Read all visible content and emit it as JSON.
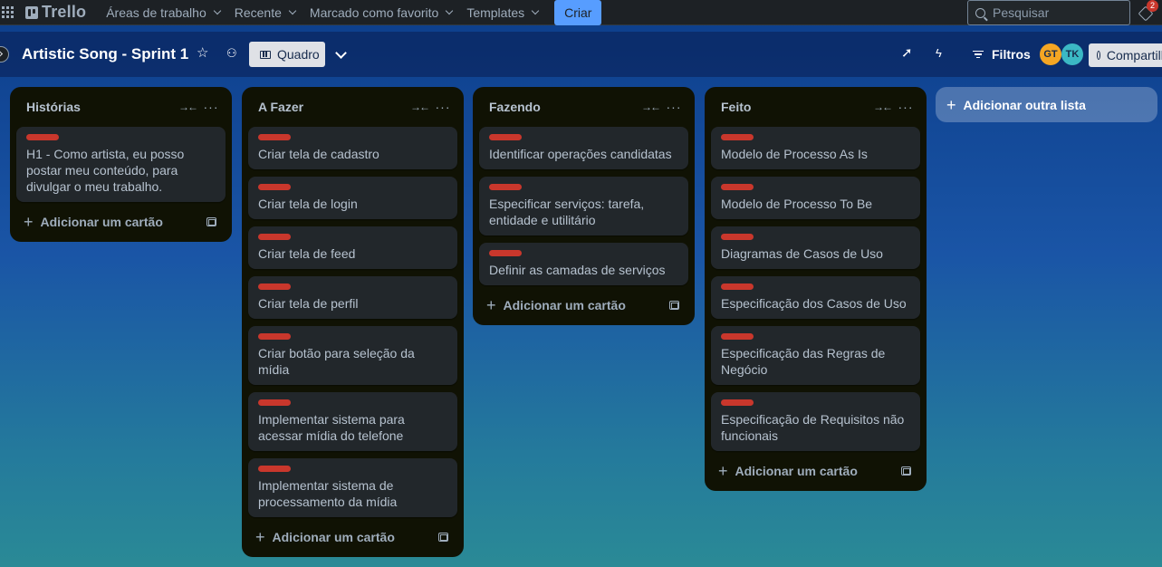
{
  "topnav": {
    "logo_text": "Trello",
    "menu": [
      {
        "label": "Áreas de trabalho"
      },
      {
        "label": "Recente"
      },
      {
        "label": "Marcado como favorito"
      },
      {
        "label": "Templates"
      }
    ],
    "create_label": "Criar",
    "search_placeholder": "Pesquisar",
    "notifications_count": "2"
  },
  "board": {
    "title": "Artistic Song - Sprint 1",
    "view_label": "Quadro",
    "filters_label": "Filtros",
    "share_label": "Compartilhar",
    "members": [
      {
        "initials": "GT",
        "color": "#f5a623"
      },
      {
        "initials": "TK",
        "color": "#3bb8c4"
      }
    ]
  },
  "lists": [
    {
      "title": "Histórias",
      "cards": [
        {
          "text": "H1 - Como artista, eu posso postar meu conteúdo, para divulgar o meu trabalho.",
          "label_color": "#c9372c"
        }
      ],
      "add_card_label": "Adicionar um cartão"
    },
    {
      "title": "A Fazer",
      "cards": [
        {
          "text": "Criar tela de cadastro",
          "label_color": "#c9372c"
        },
        {
          "text": "Criar tela de login",
          "label_color": "#c9372c"
        },
        {
          "text": "Criar tela de feed",
          "label_color": "#c9372c"
        },
        {
          "text": "Criar tela de perfil",
          "label_color": "#c9372c"
        },
        {
          "text": "Criar botão para seleção da mídia",
          "label_color": "#c9372c"
        },
        {
          "text": "Implementar sistema para acessar mídia do telefone",
          "label_color": "#c9372c"
        },
        {
          "text": "Implementar sistema de processamento da mídia",
          "label_color": "#c9372c"
        }
      ],
      "add_card_label": "Adicionar um cartão"
    },
    {
      "title": "Fazendo",
      "cards": [
        {
          "text": "Identificar operações candidatas",
          "label_color": "#c9372c"
        },
        {
          "text": "Especificar serviços: tarefa, entidade e utilitário",
          "label_color": "#c9372c"
        },
        {
          "text": "Definir as camadas de serviços",
          "label_color": "#c9372c"
        }
      ],
      "add_card_label": "Adicionar um cartão"
    },
    {
      "title": "Feito",
      "cards": [
        {
          "text": "Modelo de Processo As Is",
          "label_color": "#c9372c"
        },
        {
          "text": "Modelo de Processo To Be",
          "label_color": "#c9372c"
        },
        {
          "text": "Diagramas de Casos de Uso",
          "label_color": "#c9372c"
        },
        {
          "text": "Especificação dos Casos de Uso",
          "label_color": "#c9372c"
        },
        {
          "text": "Especificação das Regras de Negócio",
          "label_color": "#c9372c"
        },
        {
          "text": "Especificação de Requisitos não funcionais",
          "label_color": "#c9372c"
        }
      ],
      "add_card_label": "Adicionar um cartão"
    }
  ],
  "add_list_label": "Adicionar outra lista"
}
